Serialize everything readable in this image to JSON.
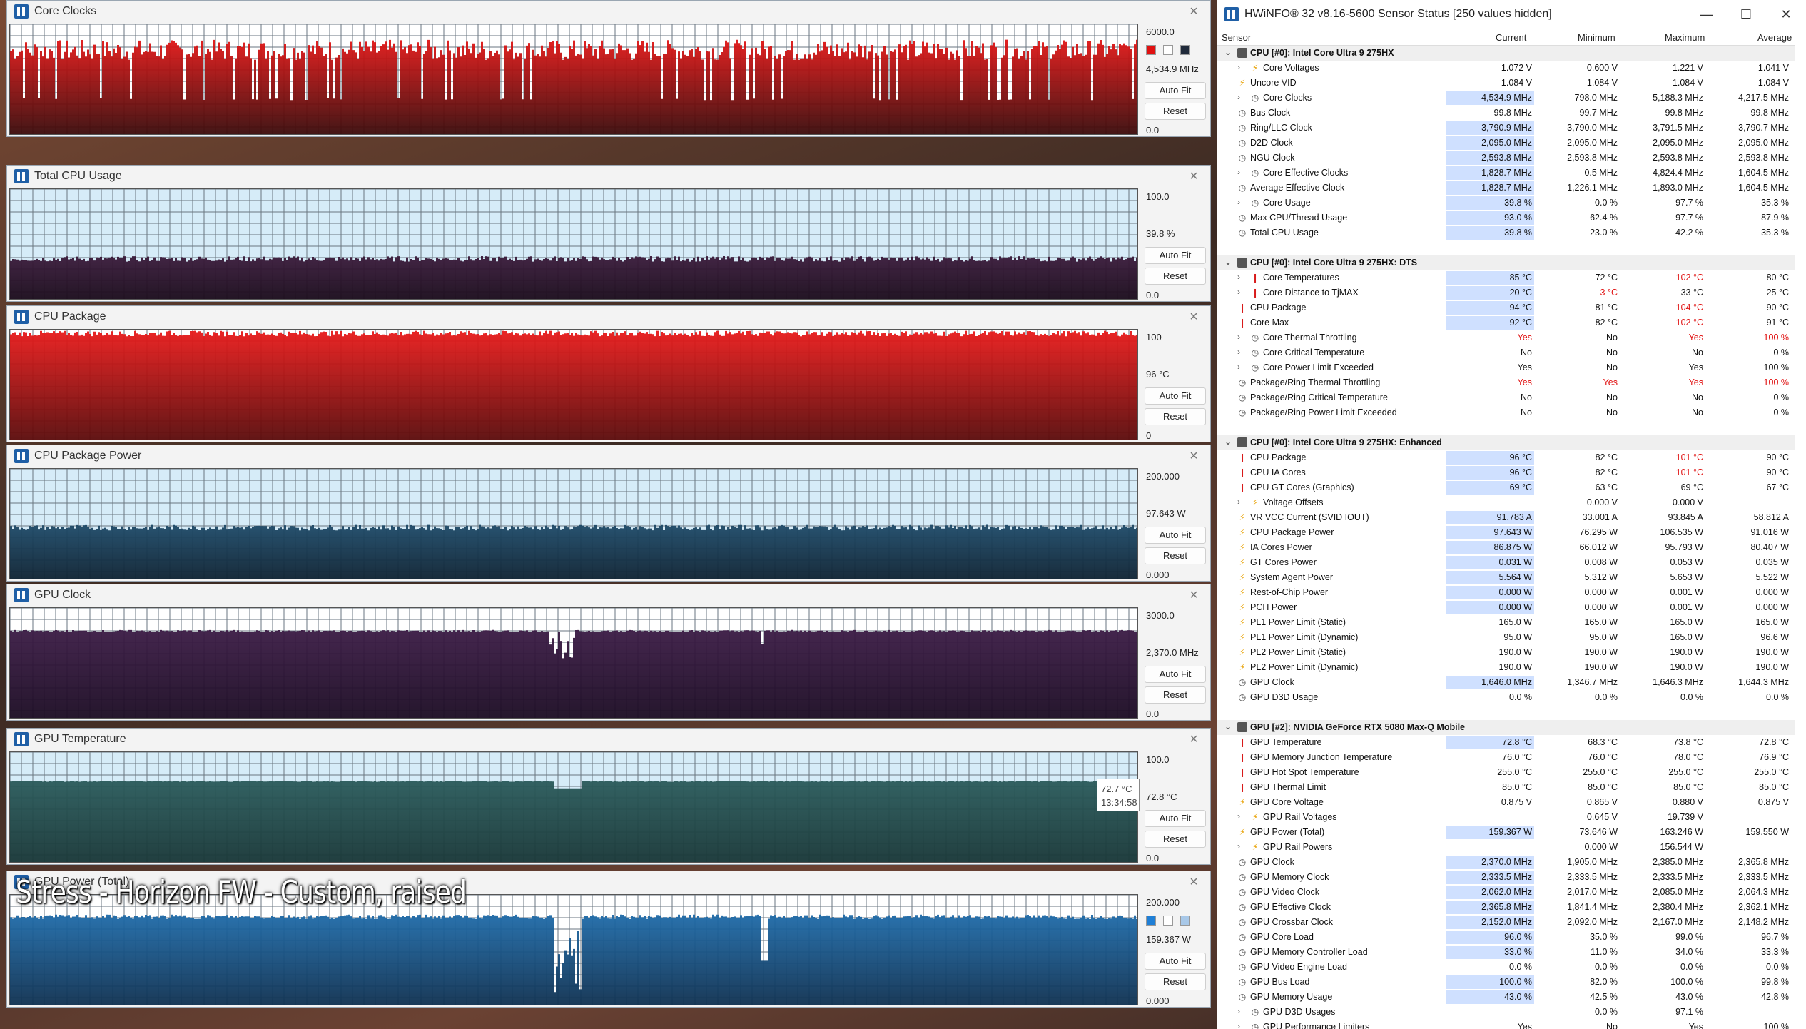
{
  "graphs": [
    {
      "title": "Core Clocks",
      "max": "6000.0",
      "current": "4,534.9 MHz",
      "min": "0.0",
      "auto_fit": "Auto Fit",
      "reset": "Reset",
      "swatches": [
        "#e01010",
        "#ffffff",
        "#1f2a3a"
      ],
      "level": 0.78,
      "color_top": "#e01616",
      "color_bottom": "#3a0a0a",
      "bg": "#ffffff",
      "pattern": "spiky"
    },
    {
      "title": "Total CPU Usage",
      "max": "100.0",
      "current": "39.8 %",
      "min": "0.0",
      "auto_fit": "Auto Fit",
      "reset": "Reset",
      "swatches": [],
      "level": 0.36,
      "color_top": "#3a1a3a",
      "color_bottom": "#1a0a1a",
      "bg": "#d6ecf8",
      "pattern": "flat"
    },
    {
      "title": "CPU Package",
      "max": "100",
      "current": "96 °C",
      "min": "0",
      "auto_fit": "Auto Fit",
      "reset": "Reset",
      "swatches": [],
      "level": 0.96,
      "color_top": "#e81a1a",
      "color_bottom": "#5a0a0a",
      "bg": "#ffffff",
      "pattern": "flat"
    },
    {
      "title": "CPU Package Power",
      "max": "200.000",
      "current": "97.643 W",
      "min": "0.000",
      "auto_fit": "Auto Fit",
      "reset": "Reset",
      "swatches": [],
      "level": 0.46,
      "color_top": "#1e4a68",
      "color_bottom": "#0e2232",
      "bg": "#d6ecf8",
      "pattern": "flat"
    },
    {
      "title": "GPU Clock",
      "max": "3000.0",
      "current": "2,370.0 MHz",
      "min": "0.0",
      "auto_fit": "Auto Fit",
      "reset": "Reset",
      "swatches": [],
      "level": 0.79,
      "color_top": "#3a1a44",
      "color_bottom": "#1a0a22",
      "bg": "#ffffff",
      "pattern": "gpuclk"
    },
    {
      "title": "GPU Temperature",
      "max": "100.0",
      "current": "72.8 °C",
      "min": "0.0",
      "auto_fit": "Auto Fit",
      "reset": "Reset",
      "swatches": [],
      "level": 0.73,
      "color_top": "#2a5a5a",
      "color_bottom": "#183636",
      "bg": "#d6ecf8",
      "pattern": "temp"
    },
    {
      "title": "GPU Power (Total)",
      "max": "200.000",
      "current": "159.367 W",
      "min": "0.000",
      "auto_fit": "Auto Fit",
      "reset": "Reset",
      "swatches": [
        "#1f7fd6",
        "#ffffff",
        "#a8c8e8"
      ],
      "level": 0.8,
      "color_top": "#1e6aa8",
      "color_bottom": "#0e3050",
      "bg": "#ffffff",
      "pattern": "gpupow"
    }
  ],
  "tooltip": {
    "value": "72.7 °C",
    "time": "13:34:58"
  },
  "overlay": "Stress - Horizon FW - Custom, raised",
  "sensor_window": {
    "title": "HWiNFO® 32 v8.16-5600 Sensor Status [250 values hidden]",
    "controls": [
      "—",
      "☐",
      "✕"
    ],
    "columns": [
      "Sensor",
      "Current",
      "Minimum",
      "Maximum",
      "Average"
    ],
    "rows": [
      {
        "t": "hdr",
        "name": "CPU [#0]: Intel Core Ultra 9 275HX"
      },
      {
        "t": "s",
        "exp": true,
        "icon": "bolt",
        "name": "Core Voltages",
        "v": [
          "1.072 V",
          "0.600 V",
          "1.221 V",
          "1.041 V"
        ]
      },
      {
        "t": "s",
        "icon": "bolt",
        "name": "Uncore VID",
        "v": [
          "1.084 V",
          "1.084 V",
          "1.084 V",
          "1.084 V"
        ]
      },
      {
        "t": "s",
        "exp": true,
        "icon": "clk",
        "name": "Core Clocks",
        "hl": true,
        "v": [
          "4,534.9 MHz",
          "798.0 MHz",
          "5,188.3 MHz",
          "4,217.5 MHz"
        ]
      },
      {
        "t": "s",
        "icon": "clk",
        "name": "Bus Clock",
        "v": [
          "99.8 MHz",
          "99.7 MHz",
          "99.8 MHz",
          "99.8 MHz"
        ]
      },
      {
        "t": "s",
        "icon": "clk",
        "name": "Ring/LLC Clock",
        "hl": true,
        "v": [
          "3,790.9 MHz",
          "3,790.0 MHz",
          "3,791.5 MHz",
          "3,790.7 MHz"
        ]
      },
      {
        "t": "s",
        "icon": "clk",
        "name": "D2D Clock",
        "hl": true,
        "v": [
          "2,095.0 MHz",
          "2,095.0 MHz",
          "2,095.0 MHz",
          "2,095.0 MHz"
        ]
      },
      {
        "t": "s",
        "icon": "clk",
        "name": "NGU Clock",
        "hl": true,
        "v": [
          "2,593.8 MHz",
          "2,593.8 MHz",
          "2,593.8 MHz",
          "2,593.8 MHz"
        ]
      },
      {
        "t": "s",
        "exp": true,
        "icon": "clk",
        "name": "Core Effective Clocks",
        "hl": true,
        "v": [
          "1,828.7 MHz",
          "0.5 MHz",
          "4,824.4 MHz",
          "1,604.5 MHz"
        ]
      },
      {
        "t": "s",
        "icon": "clk",
        "name": "Average Effective Clock",
        "hl": true,
        "v": [
          "1,828.7 MHz",
          "1,226.1 MHz",
          "1,893.0 MHz",
          "1,604.5 MHz"
        ]
      },
      {
        "t": "s",
        "exp": true,
        "icon": "clk",
        "name": "Core Usage",
        "hl": true,
        "v": [
          "39.8 %",
          "0.0 %",
          "97.7 %",
          "35.3 %"
        ]
      },
      {
        "t": "s",
        "icon": "clk",
        "name": "Max CPU/Thread Usage",
        "hl": true,
        "v": [
          "93.0 %",
          "62.4 %",
          "97.7 %",
          "87.9 %"
        ]
      },
      {
        "t": "s",
        "icon": "clk",
        "name": "Total CPU Usage",
        "hl": true,
        "v": [
          "39.8 %",
          "23.0 %",
          "42.2 %",
          "35.3 %"
        ]
      },
      {
        "t": "gap"
      },
      {
        "t": "hdr",
        "name": "CPU [#0]: Intel Core Ultra 9 275HX: DTS"
      },
      {
        "t": "s",
        "exp": true,
        "icon": "th",
        "name": "Core Temperatures",
        "hl": true,
        "v": [
          "85 °C",
          "72 °C",
          "102 °C",
          "80 °C"
        ],
        "red": [
          2
        ]
      },
      {
        "t": "s",
        "exp": true,
        "icon": "th",
        "name": "Core Distance to TjMAX",
        "hl": true,
        "v": [
          "20 °C",
          "3 °C",
          "33 °C",
          "25 °C"
        ],
        "red": [
          1
        ]
      },
      {
        "t": "s",
        "icon": "th",
        "name": "CPU Package",
        "hl": true,
        "v": [
          "94 °C",
          "81 °C",
          "104 °C",
          "90 °C"
        ],
        "red": [
          2
        ]
      },
      {
        "t": "s",
        "icon": "th",
        "name": "Core Max",
        "hl": true,
        "v": [
          "92 °C",
          "82 °C",
          "102 °C",
          "91 °C"
        ],
        "red": [
          2
        ]
      },
      {
        "t": "s",
        "exp": true,
        "icon": "clk",
        "name": "Core Thermal Throttling",
        "v": [
          "Yes",
          "No",
          "Yes",
          "100 %"
        ],
        "red": [
          0,
          2,
          3
        ]
      },
      {
        "t": "s",
        "exp": true,
        "icon": "clk",
        "name": "Core Critical Temperature",
        "v": [
          "No",
          "No",
          "No",
          "0 %"
        ]
      },
      {
        "t": "s",
        "exp": true,
        "icon": "clk",
        "name": "Core Power Limit Exceeded",
        "v": [
          "Yes",
          "No",
          "Yes",
          "100 %"
        ]
      },
      {
        "t": "s",
        "icon": "clk",
        "name": "Package/Ring Thermal Throttling",
        "v": [
          "Yes",
          "Yes",
          "Yes",
          "100 %"
        ],
        "red": [
          0,
          1,
          2,
          3
        ]
      },
      {
        "t": "s",
        "icon": "clk",
        "name": "Package/Ring Critical Temperature",
        "v": [
          "No",
          "No",
          "No",
          "0 %"
        ]
      },
      {
        "t": "s",
        "icon": "clk",
        "name": "Package/Ring Power Limit Exceeded",
        "v": [
          "No",
          "No",
          "No",
          "0 %"
        ]
      },
      {
        "t": "gap"
      },
      {
        "t": "hdr",
        "name": "CPU [#0]: Intel Core Ultra 9 275HX: Enhanced"
      },
      {
        "t": "s",
        "icon": "th",
        "name": "CPU Package",
        "hl": true,
        "v": [
          "96 °C",
          "82 °C",
          "101 °C",
          "90 °C"
        ],
        "red": [
          2
        ]
      },
      {
        "t": "s",
        "icon": "th",
        "name": "CPU IA Cores",
        "hl": true,
        "v": [
          "96 °C",
          "82 °C",
          "101 °C",
          "90 °C"
        ],
        "red": [
          2
        ]
      },
      {
        "t": "s",
        "icon": "th",
        "name": "CPU GT Cores (Graphics)",
        "hl": true,
        "v": [
          "69 °C",
          "63 °C",
          "69 °C",
          "67 °C"
        ]
      },
      {
        "t": "s",
        "exp": true,
        "icon": "bolt",
        "name": "Voltage Offsets",
        "v": [
          "",
          "0.000 V",
          "0.000 V",
          ""
        ]
      },
      {
        "t": "s",
        "icon": "bolt",
        "name": "VR VCC Current (SVID IOUT)",
        "hl": true,
        "v": [
          "91.783 A",
          "33.001 A",
          "93.845 A",
          "58.812 A"
        ]
      },
      {
        "t": "s",
        "icon": "bolt",
        "name": "CPU Package Power",
        "hl": true,
        "v": [
          "97.643 W",
          "76.295 W",
          "106.535 W",
          "91.016 W"
        ]
      },
      {
        "t": "s",
        "icon": "bolt",
        "name": "IA Cores Power",
        "hl": true,
        "v": [
          "86.875 W",
          "66.012 W",
          "95.793 W",
          "80.407 W"
        ]
      },
      {
        "t": "s",
        "icon": "bolt",
        "name": "GT Cores Power",
        "hl": true,
        "v": [
          "0.031 W",
          "0.008 W",
          "0.053 W",
          "0.035 W"
        ]
      },
      {
        "t": "s",
        "icon": "bolt",
        "name": "System Agent Power",
        "hl": true,
        "v": [
          "5.564 W",
          "5.312 W",
          "5.653 W",
          "5.522 W"
        ]
      },
      {
        "t": "s",
        "icon": "bolt",
        "name": "Rest-of-Chip Power",
        "hl": true,
        "v": [
          "0.000 W",
          "0.000 W",
          "0.001 W",
          "0.000 W"
        ]
      },
      {
        "t": "s",
        "icon": "bolt",
        "name": "PCH Power",
        "hl": true,
        "v": [
          "0.000 W",
          "0.000 W",
          "0.001 W",
          "0.000 W"
        ]
      },
      {
        "t": "s",
        "icon": "bolt",
        "name": "PL1 Power Limit (Static)",
        "v": [
          "165.0 W",
          "165.0 W",
          "165.0 W",
          "165.0 W"
        ]
      },
      {
        "t": "s",
        "icon": "bolt",
        "name": "PL1 Power Limit (Dynamic)",
        "v": [
          "95.0 W",
          "95.0 W",
          "165.0 W",
          "96.6 W"
        ]
      },
      {
        "t": "s",
        "icon": "bolt",
        "name": "PL2 Power Limit (Static)",
        "v": [
          "190.0 W",
          "190.0 W",
          "190.0 W",
          "190.0 W"
        ]
      },
      {
        "t": "s",
        "icon": "bolt",
        "name": "PL2 Power Limit (Dynamic)",
        "v": [
          "190.0 W",
          "190.0 W",
          "190.0 W",
          "190.0 W"
        ]
      },
      {
        "t": "s",
        "icon": "clk",
        "name": "GPU Clock",
        "hl": true,
        "v": [
          "1,646.0 MHz",
          "1,346.7 MHz",
          "1,646.3 MHz",
          "1,644.3 MHz"
        ]
      },
      {
        "t": "s",
        "icon": "clk",
        "name": "GPU D3D Usage",
        "v": [
          "0.0 %",
          "0.0 %",
          "0.0 %",
          "0.0 %"
        ]
      },
      {
        "t": "gap"
      },
      {
        "t": "hdr",
        "name": "GPU [#2]: NVIDIA  GeForce RTX 5080 Max-Q Mobile"
      },
      {
        "t": "s",
        "icon": "th",
        "name": "GPU Temperature",
        "hl": true,
        "v": [
          "72.8 °C",
          "68.3 °C",
          "73.8 °C",
          "72.8 °C"
        ]
      },
      {
        "t": "s",
        "icon": "th",
        "name": "GPU Memory Junction Temperature",
        "v": [
          "76.0 °C",
          "76.0 °C",
          "78.0 °C",
          "76.9 °C"
        ]
      },
      {
        "t": "s",
        "icon": "th",
        "name": "GPU Hot Spot Temperature",
        "v": [
          "255.0 °C",
          "255.0 °C",
          "255.0 °C",
          "255.0 °C"
        ]
      },
      {
        "t": "s",
        "icon": "th",
        "name": "GPU Thermal Limit",
        "v": [
          "85.0 °C",
          "85.0 °C",
          "85.0 °C",
          "85.0 °C"
        ]
      },
      {
        "t": "s",
        "icon": "bolt",
        "name": "GPU Core Voltage",
        "v": [
          "0.875 V",
          "0.865 V",
          "0.880 V",
          "0.875 V"
        ]
      },
      {
        "t": "s",
        "exp": true,
        "icon": "bolt",
        "name": "GPU Rail Voltages",
        "v": [
          "",
          "0.645 V",
          "19.739 V",
          ""
        ]
      },
      {
        "t": "s",
        "icon": "bolt",
        "name": "GPU Power (Total)",
        "hl": true,
        "v": [
          "159.367 W",
          "73.646 W",
          "163.246 W",
          "159.550 W"
        ]
      },
      {
        "t": "s",
        "exp": true,
        "icon": "bolt",
        "name": "GPU Rail Powers",
        "v": [
          "",
          "0.000 W",
          "156.544 W",
          ""
        ]
      },
      {
        "t": "s",
        "icon": "clk",
        "name": "GPU Clock",
        "hl": true,
        "v": [
          "2,370.0 MHz",
          "1,905.0 MHz",
          "2,385.0 MHz",
          "2,365.8 MHz"
        ]
      },
      {
        "t": "s",
        "icon": "clk",
        "name": "GPU Memory Clock",
        "hl": true,
        "v": [
          "2,333.5 MHz",
          "2,333.5 MHz",
          "2,333.5 MHz",
          "2,333.5 MHz"
        ]
      },
      {
        "t": "s",
        "icon": "clk",
        "name": "GPU Video Clock",
        "hl": true,
        "v": [
          "2,062.0 MHz",
          "2,017.0 MHz",
          "2,085.0 MHz",
          "2,064.3 MHz"
        ]
      },
      {
        "t": "s",
        "icon": "clk",
        "name": "GPU Effective Clock",
        "hl": true,
        "v": [
          "2,365.8 MHz",
          "1,841.4 MHz",
          "2,380.4 MHz",
          "2,362.1 MHz"
        ]
      },
      {
        "t": "s",
        "icon": "clk",
        "name": "GPU Crossbar Clock",
        "hl": true,
        "v": [
          "2,152.0 MHz",
          "2,092.0 MHz",
          "2,167.0 MHz",
          "2,148.2 MHz"
        ]
      },
      {
        "t": "s",
        "icon": "clk",
        "name": "GPU Core Load",
        "hl": true,
        "v": [
          "96.0 %",
          "35.0 %",
          "99.0 %",
          "96.7 %"
        ]
      },
      {
        "t": "s",
        "icon": "clk",
        "name": "GPU Memory Controller Load",
        "hl": true,
        "v": [
          "33.0 %",
          "11.0 %",
          "34.0 %",
          "33.3 %"
        ]
      },
      {
        "t": "s",
        "icon": "clk",
        "name": "GPU Video Engine Load",
        "v": [
          "0.0 %",
          "0.0 %",
          "0.0 %",
          "0.0 %"
        ]
      },
      {
        "t": "s",
        "icon": "clk",
        "name": "GPU Bus Load",
        "hl": true,
        "v": [
          "100.0 %",
          "82.0 %",
          "100.0 %",
          "99.8 %"
        ]
      },
      {
        "t": "s",
        "icon": "clk",
        "name": "GPU Memory Usage",
        "hl": true,
        "v": [
          "43.0 %",
          "42.5 %",
          "43.0 %",
          "42.8 %"
        ]
      },
      {
        "t": "s",
        "exp": true,
        "icon": "clk",
        "name": "GPU D3D Usages",
        "v": [
          "",
          "0.0 %",
          "97.1 %",
          ""
        ]
      },
      {
        "t": "s",
        "exp": true,
        "icon": "clk",
        "name": "GPU Performance Limiters",
        "v": [
          "Yes",
          "No",
          "Yes",
          "100 %"
        ]
      }
    ]
  }
}
